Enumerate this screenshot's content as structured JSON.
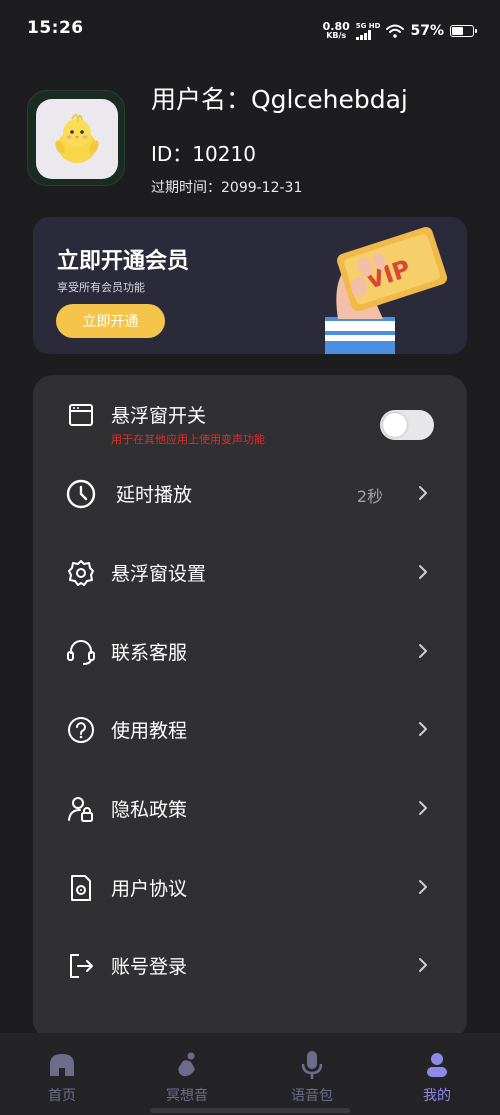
{
  "status_bar": {
    "time": "15:26",
    "net_speed": "0.80",
    "net_unit": "KB/s",
    "net_tag": "5G HD",
    "battery": "57%",
    "battery_level": 0.57
  },
  "profile": {
    "username": "用户名：Qglcehebdaj",
    "id": "ID：10210",
    "expire": "过期时间：2099-12-31"
  },
  "vip": {
    "title": "立即开通会员",
    "subtitle": "享受所有会员功能",
    "button": "立即开通",
    "card_text": "VIP"
  },
  "menu": {
    "floating_toggle": {
      "label": "悬浮窗开关",
      "hint": "用于在其他应用上使用变声功能",
      "on": false
    },
    "delay": {
      "label": "延时播放",
      "value": "2秒"
    },
    "floating_settings": {
      "label": "悬浮窗设置"
    },
    "support": {
      "label": "联系客服"
    },
    "tutorial": {
      "label": "使用教程"
    },
    "privacy": {
      "label": "隐私政策"
    },
    "agreement": {
      "label": "用户协议"
    },
    "login": {
      "label": "账号登录"
    }
  },
  "nav": {
    "home": "首页",
    "meditation": "冥想音",
    "voice_pack": "语音包",
    "mine": "我的",
    "active": "mine"
  },
  "colors": {
    "background": "#1d1d1f",
    "card": "#303032",
    "vip_card": "#2b2a3a",
    "accent_yellow": "#f4c44b",
    "hint_red": "#e02c2c",
    "nav_active": "#8d8ae8",
    "nav_inactive": "#6e6c8c"
  }
}
